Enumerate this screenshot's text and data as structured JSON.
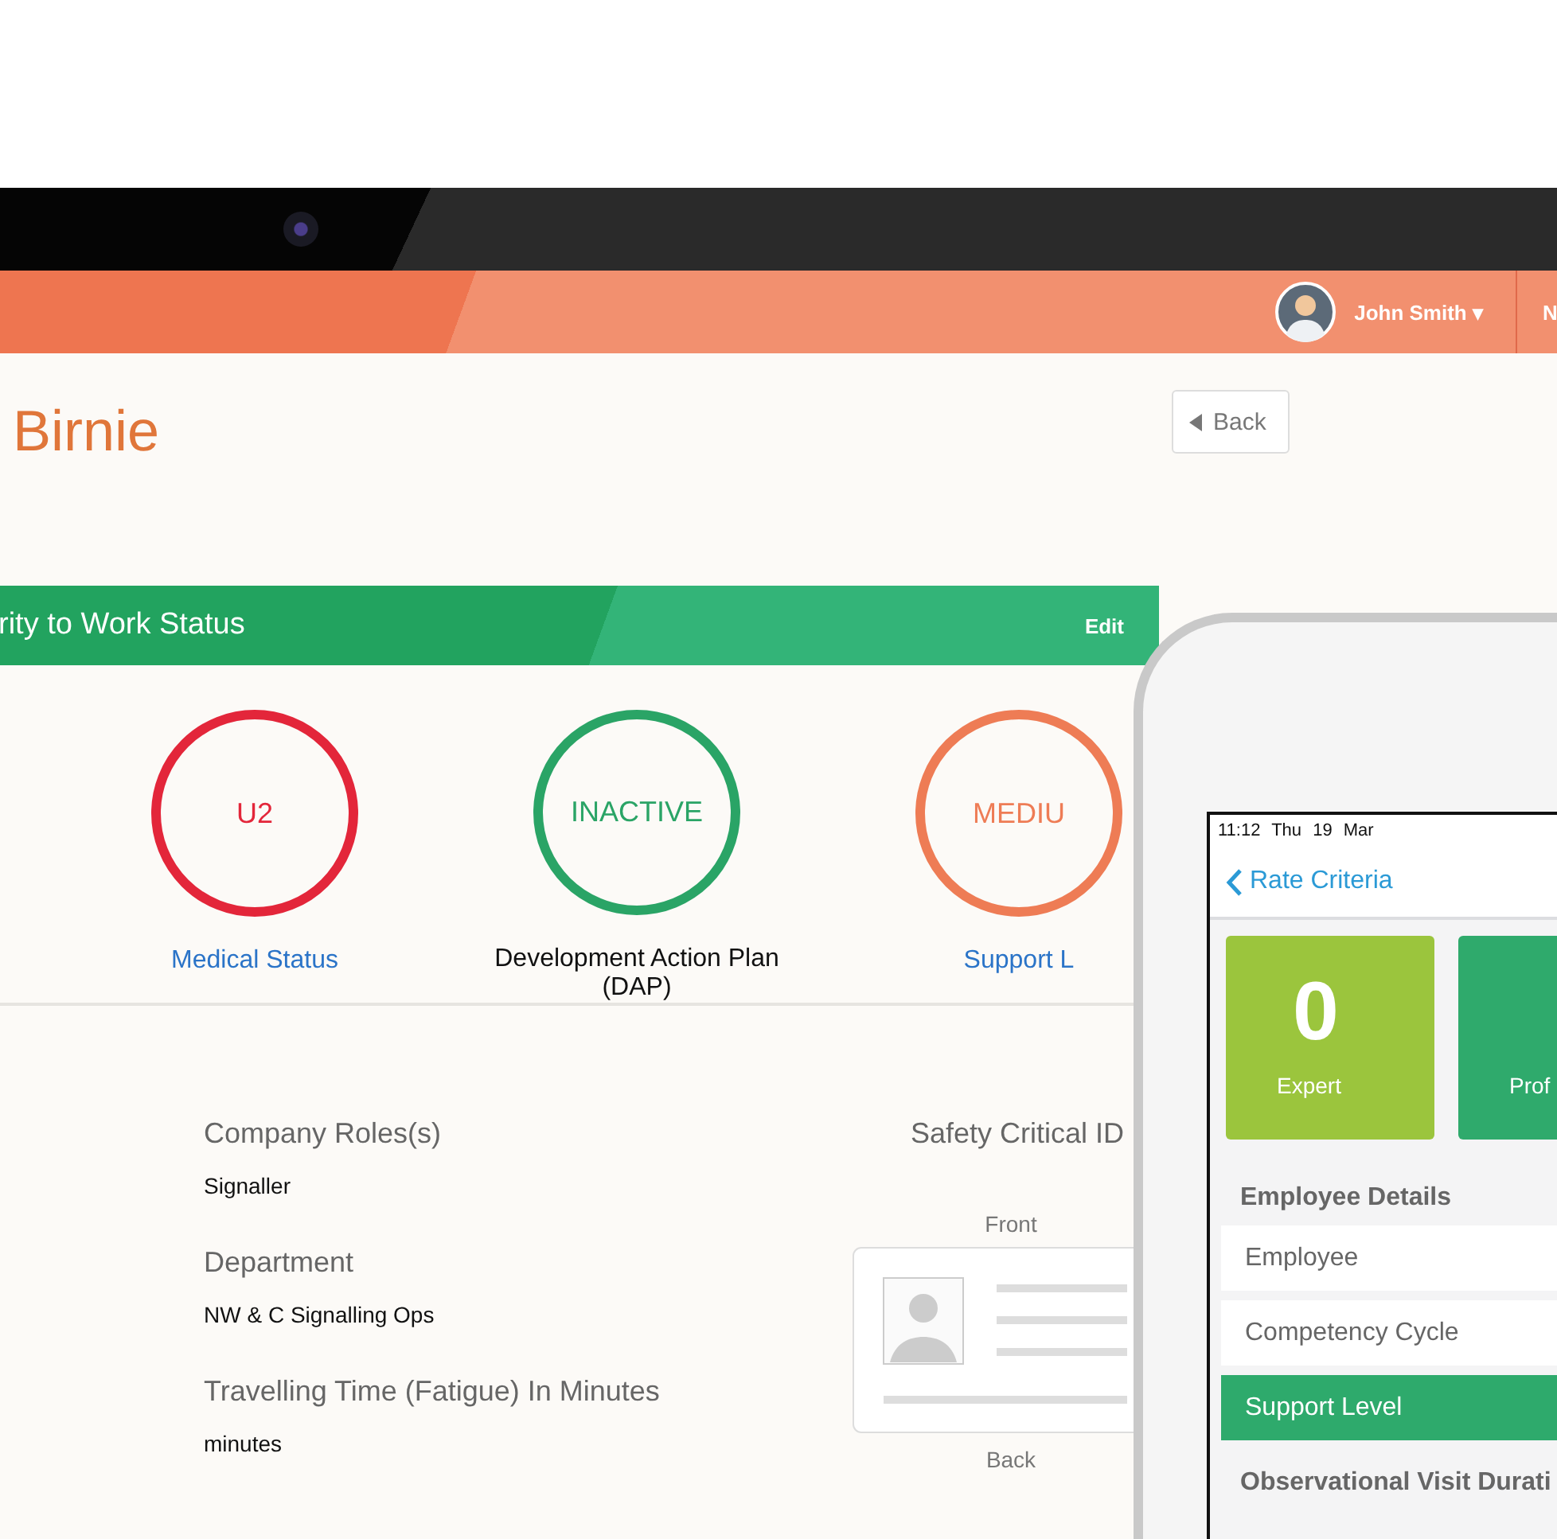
{
  "header": {
    "user_name": "John Smith",
    "caret": "▾",
    "cut_item": "N"
  },
  "page": {
    "title": "Birnie",
    "back_button": "Back"
  },
  "status_panel": {
    "title": "rity to Work Status",
    "edit": "Edit",
    "statuses": [
      {
        "value": "U2",
        "label": "Medical Status",
        "color": "#e3263a",
        "kind": "link"
      },
      {
        "value": "INACTIVE",
        "label": "Development Action Plan (DAP)",
        "color": "#2aa466",
        "kind": "text"
      },
      {
        "value": "MEDIU",
        "label": "Support L",
        "color": "#ee7c55",
        "kind": "link"
      }
    ]
  },
  "details": {
    "fields": [
      {
        "label": "Company Roles(s)",
        "value": "Signaller"
      },
      {
        "label": "Department",
        "value": "NW & C Signalling Ops"
      },
      {
        "label": "Travelling Time (Fatigue) In Minutes",
        "value": "minutes"
      }
    ],
    "id_card": {
      "title": "Safety Critical ID",
      "front": "Front",
      "back": "Back"
    }
  },
  "tablet": {
    "time": "11:12",
    "date": "Thu 19 Mar",
    "back_link": "Rate Criteria",
    "tiles": [
      {
        "count": "0",
        "label": "Expert",
        "color": "#9bc53d"
      },
      {
        "label": "Prof",
        "color": "#2faa6c"
      }
    ],
    "section": "Employee Details",
    "rows": [
      {
        "label": "Employee",
        "selected": false
      },
      {
        "label": "Competency Cycle",
        "selected": false
      },
      {
        "label": "Support Level",
        "selected": true
      }
    ],
    "next_section": "Observational Visit Durati"
  }
}
